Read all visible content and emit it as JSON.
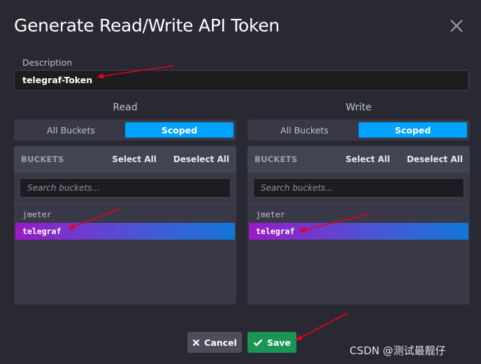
{
  "dialog": {
    "title": "Generate Read/Write API Token",
    "close_icon": "close-icon"
  },
  "description": {
    "label": "Description",
    "value": "telegraf-Token"
  },
  "read": {
    "heading": "Read",
    "toggle": {
      "all_label": "All Buckets",
      "scoped_label": "Scoped",
      "selected": "Scoped"
    },
    "header_label": "BUCKETS",
    "select_all": "Select All",
    "deselect_all": "Deselect All",
    "search_placeholder": "Search buckets...",
    "buckets": [
      {
        "name": "jmeter",
        "selected": false
      },
      {
        "name": "telegraf",
        "selected": true
      }
    ]
  },
  "write": {
    "heading": "Write",
    "toggle": {
      "all_label": "All Buckets",
      "scoped_label": "Scoped",
      "selected": "Scoped"
    },
    "header_label": "BUCKETS",
    "select_all": "Select All",
    "deselect_all": "Deselect All",
    "search_placeholder": "Search buckets...",
    "buckets": [
      {
        "name": "jmeter",
        "selected": false
      },
      {
        "name": "telegraf",
        "selected": true
      }
    ]
  },
  "footer": {
    "cancel_label": "Cancel",
    "save_label": "Save"
  },
  "watermark": "CSDN @测试最靓仔",
  "colors": {
    "background": "#292933",
    "primary": "#00a3ff",
    "success": "#1a9553",
    "annotation": "#e8001c"
  }
}
